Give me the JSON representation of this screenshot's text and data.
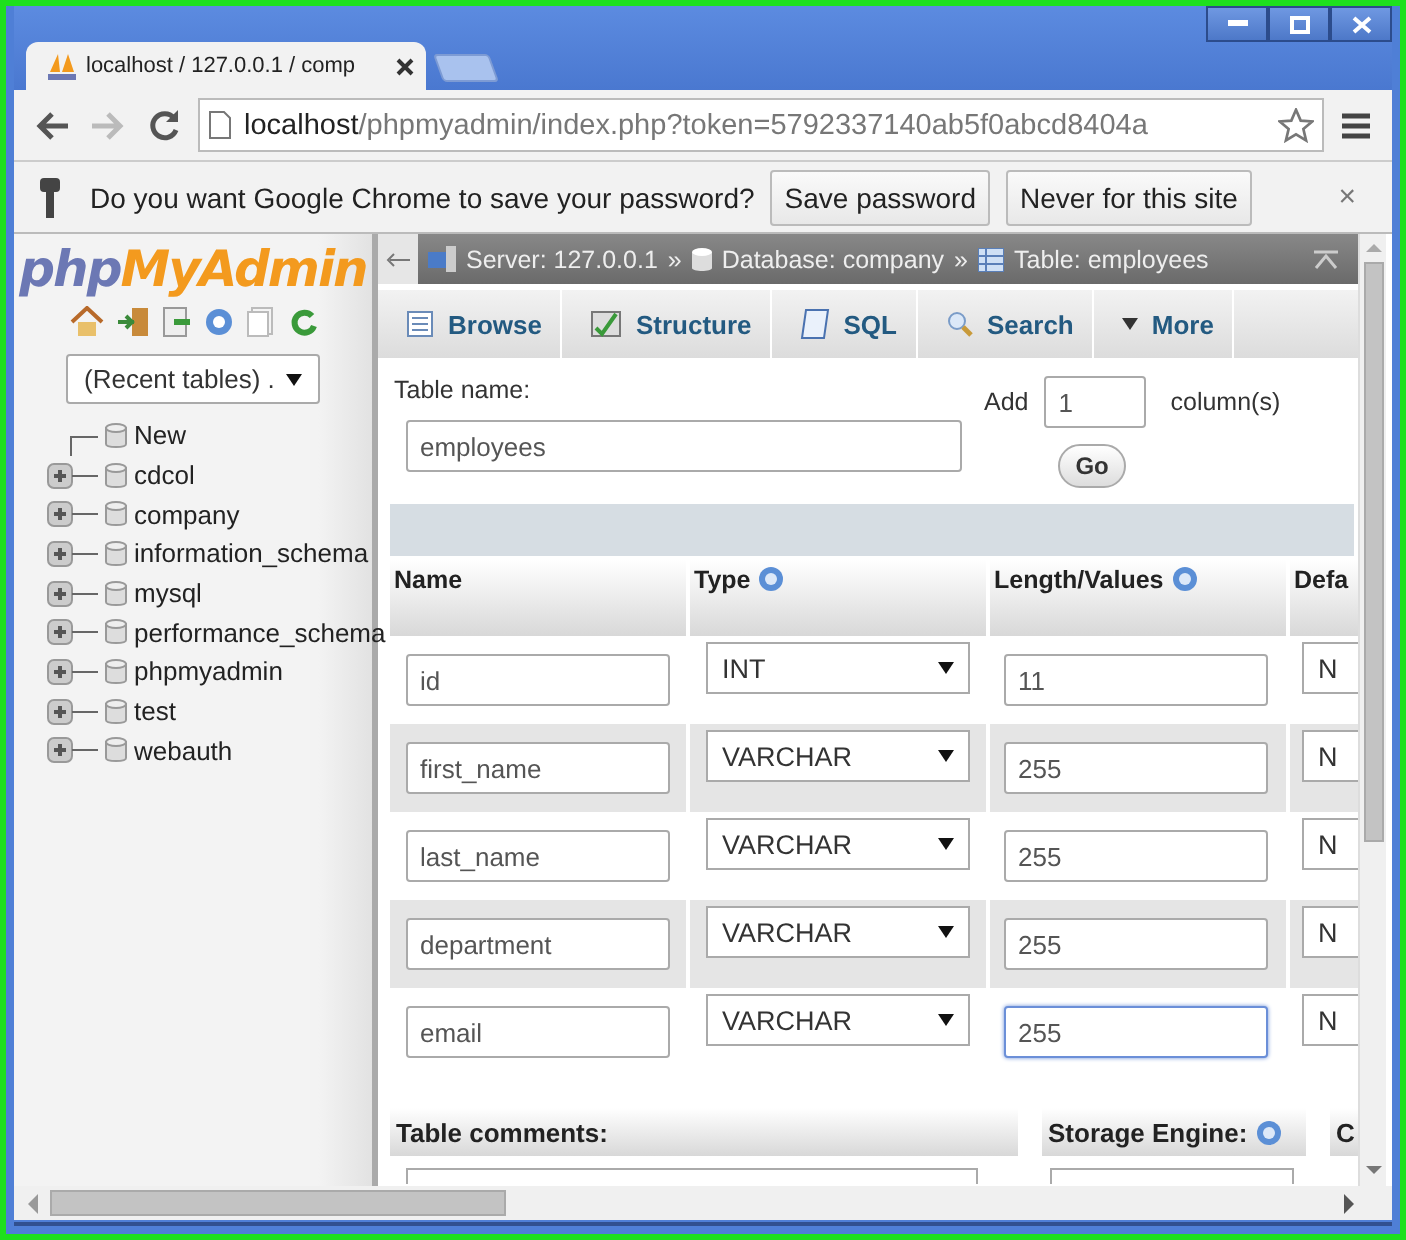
{
  "browser": {
    "tab_title": "localhost / 127.0.0.1 / comp",
    "url_host": "localhost",
    "url_path": "/phpmyadmin/index.php?token=5792337140ab5f0abcd8404a",
    "infobar": {
      "message": "Do you want Google Chrome to save your password?",
      "buttons": [
        "Save password",
        "Never for this site"
      ],
      "close": "×"
    }
  },
  "sidebar": {
    "logo": {
      "part_1": "php",
      "part_2": "MyAdmin"
    },
    "recent_tables": "(Recent tables) .",
    "tree": [
      {
        "kind": "new",
        "label": "New"
      },
      {
        "kind": "database",
        "label": "cdcol"
      },
      {
        "kind": "database",
        "label": "company"
      },
      {
        "kind": "database",
        "label": "information_schema"
      },
      {
        "kind": "database",
        "label": "mysql"
      },
      {
        "kind": "database",
        "label": "performance_schema"
      },
      {
        "kind": "database",
        "label": "phpmyadmin"
      },
      {
        "kind": "database",
        "label": "test"
      },
      {
        "kind": "database",
        "label": "webauth"
      }
    ]
  },
  "breadcrumb": {
    "separator": "»",
    "items": [
      {
        "kind": "server",
        "label": "Server: 127.0.0.1"
      },
      {
        "kind": "database",
        "label": "Database: company"
      },
      {
        "kind": "table",
        "label": "Table: employees"
      }
    ]
  },
  "tabs": [
    {
      "kind": "browse",
      "label": "Browse",
      "selected": false
    },
    {
      "kind": "structure",
      "label": "Structure",
      "selected": false
    },
    {
      "kind": "sql",
      "label": "SQL",
      "selected": false
    },
    {
      "kind": "search",
      "label": "Search",
      "selected": false
    },
    {
      "kind": "more",
      "label": "More",
      "selected": false
    }
  ],
  "form": {
    "table_name_label": "Table name:",
    "table_name": "employees",
    "add_label": "Add",
    "add_count": "1",
    "columns_label": "column(s)",
    "go": "Go"
  },
  "columns": {
    "headers": [
      {
        "label": "Name",
        "help": false
      },
      {
        "label": "Type",
        "help": true
      },
      {
        "label": "Length/Values",
        "help": true
      },
      {
        "label": "Defa"
      }
    ],
    "rows": [
      {
        "name": "id",
        "type": "INT",
        "length": "11",
        "default": "N",
        "focused": false
      },
      {
        "name": "first_name",
        "type": "VARCHAR",
        "length": "255",
        "default": "N",
        "focused": false
      },
      {
        "name": "last_name",
        "type": "VARCHAR",
        "length": "255",
        "default": "N",
        "focused": false
      },
      {
        "name": "department",
        "type": "VARCHAR",
        "length": "255",
        "default": "N",
        "focused": false
      },
      {
        "name": "email",
        "type": "VARCHAR",
        "length": "255",
        "default": "N",
        "focused": true
      }
    ]
  },
  "footer": {
    "table_comments": "Table comments:",
    "storage_engine": "Storage Engine:",
    "column_3": "C"
  }
}
